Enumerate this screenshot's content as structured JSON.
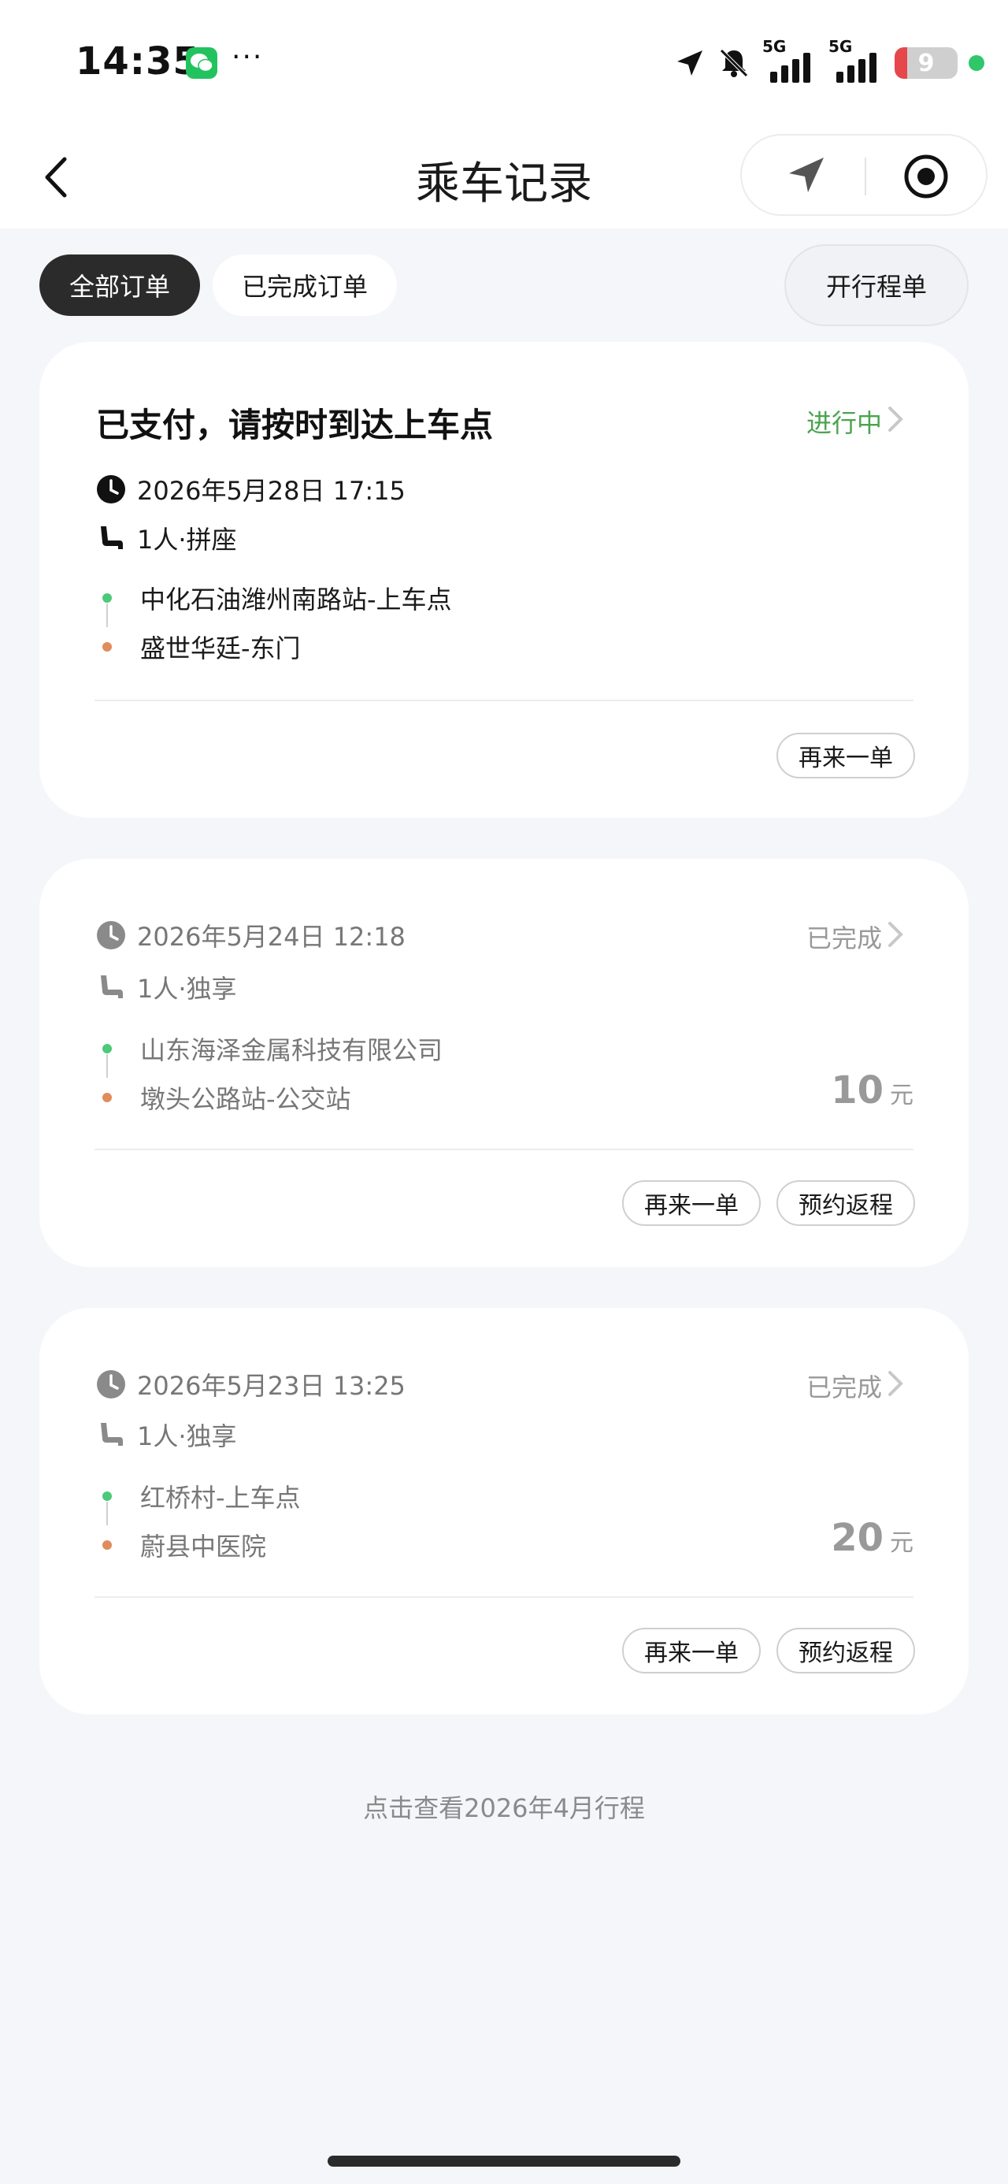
{
  "status_bar": {
    "time": "14:35",
    "dots": "···",
    "battery": "9",
    "net1": "5G",
    "net2": "5G"
  },
  "header": {
    "title": "乘车记录"
  },
  "filters": {
    "all": "全部订单",
    "completed": "已完成订单",
    "itinerary": "开行程单"
  },
  "orders": [
    {
      "title": "已支付，请按时到达上车点",
      "status": "进行中",
      "status_color": "#4aa44e",
      "datetime": "2026年5月28日 17:15",
      "seat": "1人·拼座",
      "from": "中化石油潍州南路站-上车点",
      "to": "盛世华廷-东门",
      "buttons": [
        "再来一单"
      ]
    },
    {
      "status": "已完成",
      "status_color": "#999999",
      "datetime": "2026年5月24日 12:18",
      "seat": "1人·独享",
      "from": "山东海泽金属科技有限公司",
      "to": "墩头公路站-公交站",
      "price": "10",
      "price_unit": "元",
      "buttons": [
        "再来一单",
        "预约返程"
      ]
    },
    {
      "status": "已完成",
      "status_color": "#999999",
      "datetime": "2026年5月23日 13:25",
      "seat": "1人·独享",
      "from": "红桥村-上车点",
      "to": "蔚县中医院",
      "price": "20",
      "price_unit": "元",
      "buttons": [
        "再来一单",
        "预约返程"
      ]
    }
  ],
  "footer": {
    "history_link": "点击查看2026年4月行程"
  }
}
